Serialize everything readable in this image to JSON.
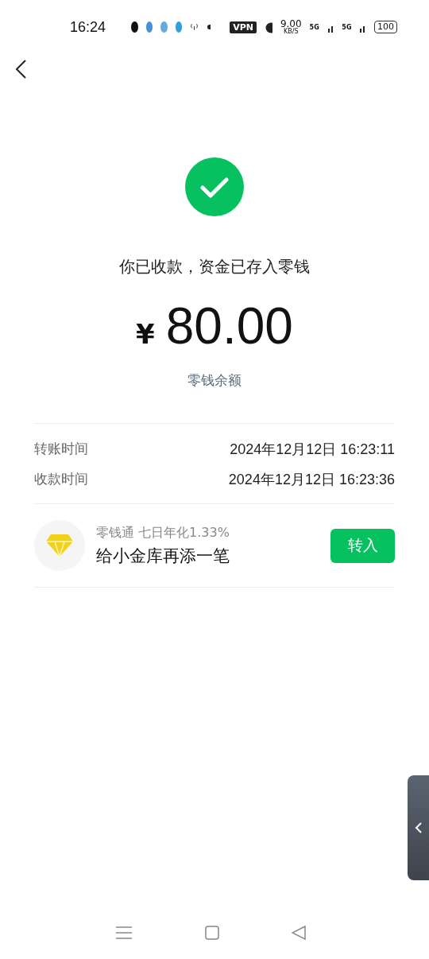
{
  "status_bar": {
    "time": "16:24",
    "vpn": "VPN",
    "speed": "9.00",
    "speed_unit": "KB/S",
    "network_1": "5G",
    "network_2": "5G",
    "battery": "100"
  },
  "result": {
    "title": "你已收款，资金已存入零钱",
    "currency": "¥",
    "amount": "80.00",
    "link": "零钱余额"
  },
  "details": [
    {
      "label": "转账时间",
      "value": "2024年12月12日 16:23:11"
    },
    {
      "label": "收款时间",
      "value": "2024年12月12日 16:23:36"
    }
  ],
  "promo": {
    "subtitle": "零钱通 七日年化1.33%",
    "title": "给小金库再添一笔",
    "button": "转入"
  }
}
